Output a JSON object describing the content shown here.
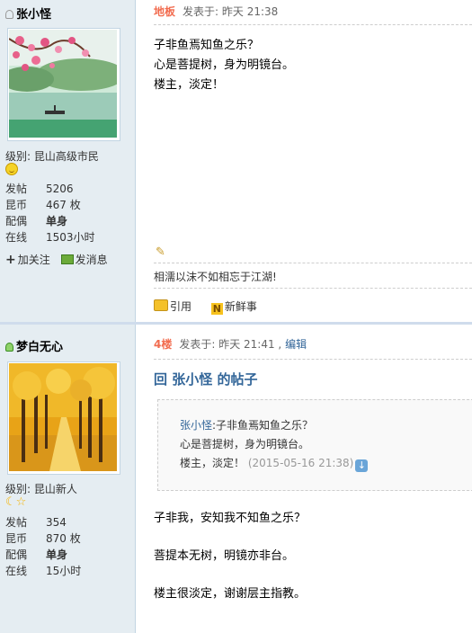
{
  "post1": {
    "author": "张小怪",
    "level_label": "级别: ",
    "level": "昆山高级市民",
    "stats": [
      {
        "key": "发帖",
        "value": "5206"
      },
      {
        "key": "昆币",
        "value": "467 枚"
      },
      {
        "key": "配偶",
        "value": "单身"
      },
      {
        "key": "在线",
        "value": "1503小时"
      }
    ],
    "follow": "加关注",
    "message": "发消息",
    "floor": "地板",
    "posted": "发表于: 昨天 21:38",
    "content": [
      "子非鱼焉知鱼之乐？",
      "心是菩提树，身为明镜台。",
      "楼主，淡定！"
    ],
    "signature": "相濡以沫不如相忘于江湖!",
    "quote_btn": "引用",
    "news_btn": "新鲜事"
  },
  "post2": {
    "author": "梦白无心",
    "level_label": "级别: ",
    "level": "昆山新人",
    "stats": [
      {
        "key": "发帖",
        "value": "354"
      },
      {
        "key": "昆币",
        "value": "870 枚"
      },
      {
        "key": "配偶",
        "value": "单身"
      },
      {
        "key": "在线",
        "value": "15小时"
      }
    ],
    "floor": "4楼",
    "posted": "发表于: 昨天 21:41 ,",
    "edit": "编辑",
    "reply_title": "回 张小怪 的帖子",
    "quote": {
      "user": "张小怪",
      "line1": ":子非鱼焉知鱼之乐？",
      "line2": "心是菩提树，身为明镜台。",
      "line3": "楼主，淡定！",
      "date": "(2015-05-16 21:38)"
    },
    "content": [
      "子非我，安知我不知鱼之乐？",
      "菩提本无树，明镜亦非台。",
      "楼主很淡定，谢谢层主指教。"
    ]
  }
}
